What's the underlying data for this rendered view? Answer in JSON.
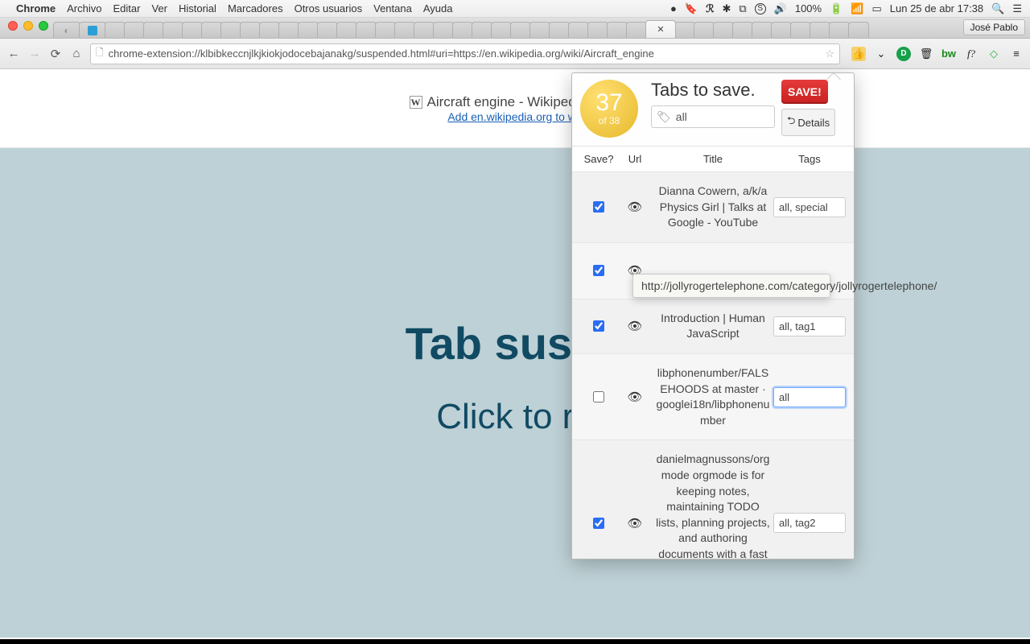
{
  "mac_menu": {
    "app": "Chrome",
    "items": [
      "Archivo",
      "Editar",
      "Ver",
      "Historial",
      "Marcadores",
      "Otros usuarios",
      "Ventana",
      "Ayuda"
    ],
    "battery": "100%",
    "clock": "Lun 25 de abr  17:38"
  },
  "user_badge": "José Pablo",
  "omnibox_url": "chrome-extension://klbibkeccnjlkjkiokjodocebajanakg/suspended.html#uri=https://en.wikipedia.org/wiki/Aircraft_engine",
  "banner": {
    "title": "Aircraft engine - Wikipedia, the f",
    "link": "Add en.wikipedia.org to wh"
  },
  "suspended": {
    "heading": "Tab suspe",
    "sub": "Click to re"
  },
  "popup": {
    "count": "37",
    "count_sub": "of 38",
    "title": "Tabs to save.",
    "save_label": "SAVE!",
    "details_label": "Details",
    "tag_value": "all",
    "columns": {
      "save": "Save?",
      "url": "Url",
      "title": "Title",
      "tags": "Tags"
    },
    "rows": [
      {
        "checked": true,
        "title": "Dianna Cowern, a/k/a Physics Girl | Talks at Google - YouTube",
        "tags": "all, special"
      },
      {
        "checked": true,
        "title": "",
        "tags": ""
      },
      {
        "checked": true,
        "title": "Introduction | Human JavaScript",
        "tags": "all, tag1"
      },
      {
        "checked": false,
        "title": "libphonenumber/FALSEHOODS at master · googlei18n/libphonenumber",
        "tags": "all",
        "focus": true
      },
      {
        "checked": true,
        "title": "danielmagnussons/orgmode orgmode is for keeping notes, maintaining TODO lists, planning projects, and authoring documents with a fast and effective plain-text system",
        "tags": "all, tag2"
      }
    ],
    "tooltip": "http://jollyrogertelephone.com/category/jollyrogertelephone/"
  }
}
